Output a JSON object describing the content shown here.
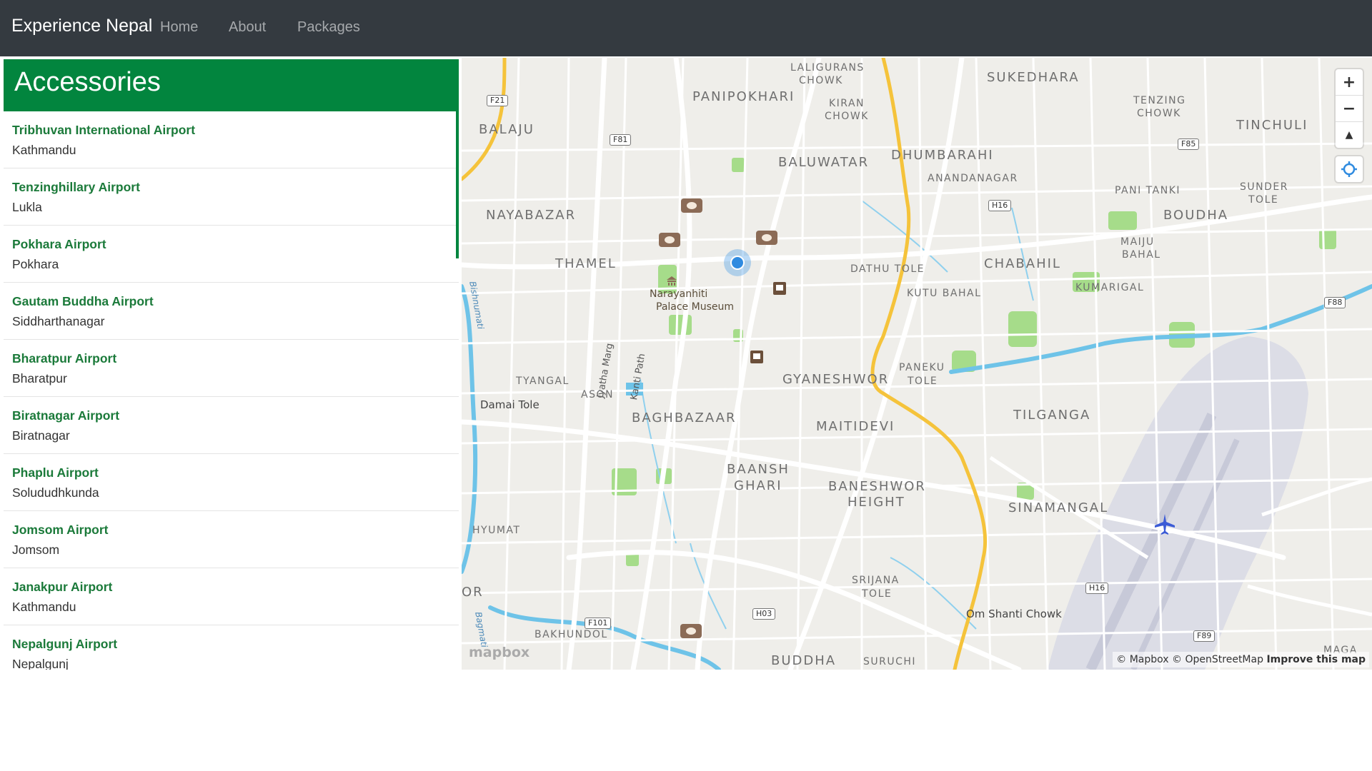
{
  "navbar": {
    "brand": "Experience Nepal",
    "links": [
      "Home",
      "About",
      "Packages"
    ]
  },
  "sidebar": {
    "title": "Accessories",
    "items": [
      {
        "name": "Tribhuvan International Airport",
        "city": "Kathmandu"
      },
      {
        "name": "Tenzinghillary Airport",
        "city": "Lukla"
      },
      {
        "name": "Pokhara Airport",
        "city": "Pokhara"
      },
      {
        "name": "Gautam Buddha Airport",
        "city": "Siddharthanagar"
      },
      {
        "name": "Bharatpur Airport",
        "city": "Bharatpur"
      },
      {
        "name": "Biratnagar Airport",
        "city": "Biratnagar"
      },
      {
        "name": "Phaplu Airport",
        "city": "Solududhkunda"
      },
      {
        "name": "Jomsom Airport",
        "city": "Jomsom"
      },
      {
        "name": "Janakpur Airport",
        "city": "Kathmandu"
      },
      {
        "name": "Nepalgunj Airport",
        "city": "Nepalgunj"
      }
    ]
  },
  "map": {
    "labels": {
      "laligurans": "LALIGURANS",
      "laligurans2": "CHOWK",
      "sukedhara": "SUKEDHARA",
      "panipokhari": "PANIPOKHARI",
      "kiran": "KIRAN",
      "kiran2": "CHOWK",
      "tenzing": "TENZING",
      "tenzing2": "CHOWK",
      "tinchuli": "TINCHULI",
      "balaju": "BALAJU",
      "baluwatar": "BALUWATAR",
      "dhumbarahi": "DHUMBARAHI",
      "anandanagar": "ANANDANAGAR",
      "panitanki": "PANI TANKI",
      "sunder": "SUNDER",
      "sunder2": "TOLE",
      "nayabazar": "NAYABAZAR",
      "boudha": "BOUDHA",
      "maiju": "MAIJU",
      "maiju2": "BAHAL",
      "thamel": "THAMEL",
      "chabahil": "CHABAHIL",
      "dathutole": "DATHU TOLE",
      "narayanhiti": "Narayanhiti",
      "narayanhiti2": "Palace Museum",
      "kumarigal": "KUMARIGAL",
      "kutubahal": "KUTU BAHAL",
      "jyatha": "Jyatha Marg",
      "kanti": "Kanti Path",
      "bishnumati": "Bishnumati",
      "paneku": "PANEKU",
      "paneku2": "TOLE",
      "tyangal": "TYANGAL",
      "gyaneshwor": "GYANESHWOR",
      "ason": "ASON",
      "damaitole": "Damai Tole",
      "tilganga": "TILGANGA",
      "baghbazaar": "BAGHBAZAAR",
      "maitidevi": "MAITIDEVI",
      "baansh": "BAANSH",
      "baansh2": "GHARI",
      "baneshwor": "BANESHWOR",
      "baneshwor2": "HEIGHT",
      "sinamangal": "SINAMANGAL",
      "hyumat": "HYUMAT",
      "srijana": "SRIJANA",
      "srijana2": "TOLE",
      "or": "OR",
      "omshanti": "Om Shanti Chowk",
      "bakhundol": "BAKHUNDOL",
      "bagmati": "Bagmati",
      "buddha": "BUDDHA",
      "suruchi": "SURUCHI",
      "maga": "MAGA"
    },
    "shields": {
      "f21": "F21",
      "f81": "F81",
      "f85": "F85",
      "h16a": "H16",
      "f88": "F88",
      "h16b": "H16",
      "h03": "H03",
      "f101": "F101",
      "f89": "F89"
    },
    "controls": {
      "zoom_in": "+",
      "zoom_out": "−",
      "compass": "▲"
    },
    "logo": "mapbox",
    "attribution": {
      "mapbox": "© Mapbox",
      "osm": "© OpenStreetMap",
      "improve": "Improve this map"
    },
    "colors": {
      "land": "#efeeea",
      "road": "#ffffff",
      "highway": "#f5c33b",
      "water": "#6ec3e8",
      "park": "#a6dc8a"
    }
  }
}
